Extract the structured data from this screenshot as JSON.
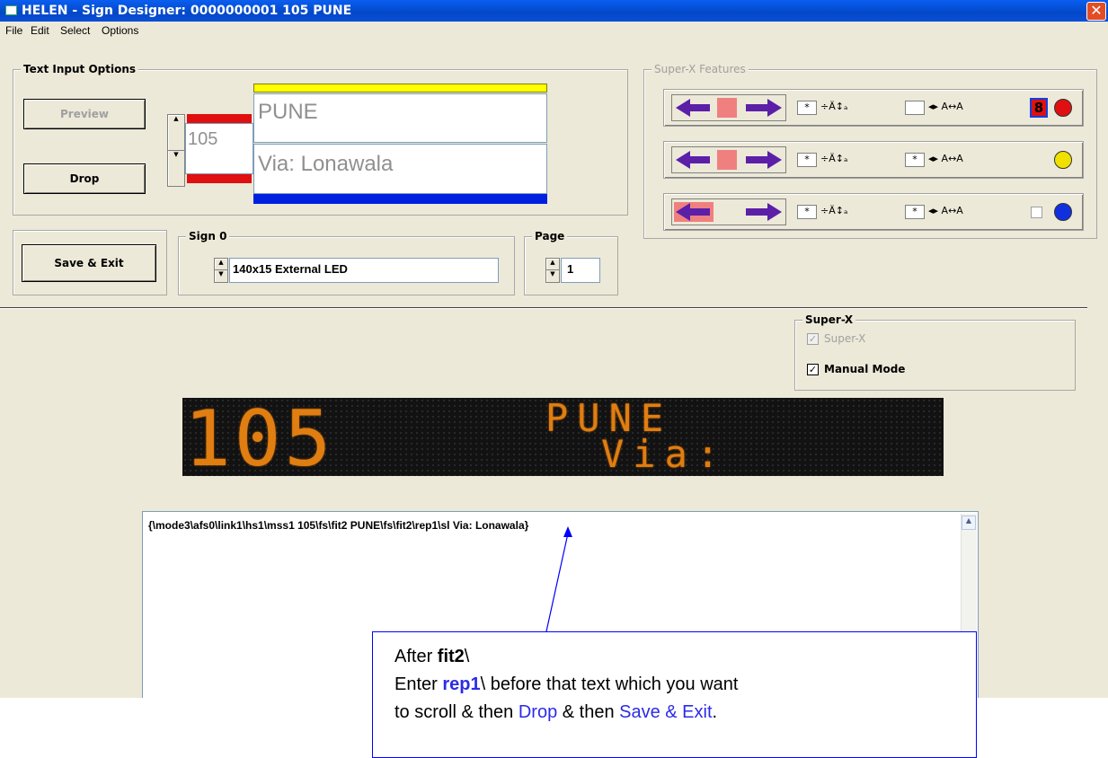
{
  "window": {
    "title": "HELEN - Sign Designer: 0000000001 105 PUNE",
    "close_glyph": "✕"
  },
  "menu": [
    "File",
    "Edit",
    "Select",
    "Options"
  ],
  "text_input": {
    "group_title": "Text Input Options",
    "preview_label": "Preview",
    "drop_label": "Drop",
    "route_number": "105",
    "line1": "PUNE",
    "line2": "Via: Lonawala"
  },
  "super_x_features": {
    "group_title": "Super-X Features",
    "row_colors": [
      "#e01010",
      "#f0e000",
      "#1030e0"
    ],
    "size_value": "*",
    "digit_badge": "8"
  },
  "save_exit_label": "Save & Exit",
  "sign": {
    "group_title": "Sign 0",
    "value": "140x15 External LED"
  },
  "page": {
    "group_title": "Page",
    "value": "1"
  },
  "super_x": {
    "group_title": "Super-X",
    "super_x_label": "Super-X",
    "manual_mode_label": "Manual Mode",
    "super_x_checked": true,
    "manual_mode_checked": true
  },
  "led_preview": {
    "number": "105",
    "line1": "PUNE",
    "line2": "Via: Lonawa"
  },
  "code": {
    "text": "{\\mode3\\afs0\\link1\\hs1\\mss1 105\\fs\\fit2 PUNE\\fs\\fit2\\rep1\\sl Via: Lonawala}"
  },
  "callout": {
    "line1_prefix": "After ",
    "line1_bold": "fit2",
    "line1_suffix": "\\",
    "line2_prefix": "Enter ",
    "line2_bold": "rep1",
    "line2_mid": "\\ before that text which you want",
    "line3_prefix": "to scroll & then ",
    "line3_drop": "Drop",
    "line3_mid": " & then ",
    "line3_save": "Save & Exit",
    "line3_suffix": "."
  }
}
